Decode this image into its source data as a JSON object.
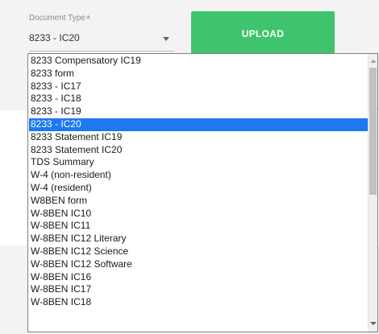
{
  "form": {
    "label": "Document Type",
    "required_mark": "*",
    "selected_value": "8233 - IC20",
    "upload_label": "UPLOAD"
  },
  "dropdown": {
    "options": [
      "8233 Compensatory IC19",
      "8233 form",
      "8233 - IC17",
      "8233 - IC18",
      "8233 - IC19",
      "8233 - IC20",
      "8233 Statement IC19",
      "8233 Statement IC20",
      "TDS Summary",
      "W-4 (non-resident)",
      "W-4 (resident)",
      "W8BEN form",
      "W-8BEN IC10",
      "W-8BEN IC11",
      "W-8BEN IC12 Literary",
      "W-8BEN IC12 Science",
      "W-8BEN IC12 Software",
      "W-8BEN IC16",
      "W-8BEN IC17",
      "W-8BEN IC18"
    ],
    "selected_index": 5
  },
  "colors": {
    "upload_button": "#3ec46d",
    "selection_highlight": "#1e78f0"
  },
  "icons": {
    "select_caret": "caret-down-icon",
    "scroll_up": "scroll-up-arrow-icon",
    "scroll_down": "scroll-down-arrow-icon"
  }
}
